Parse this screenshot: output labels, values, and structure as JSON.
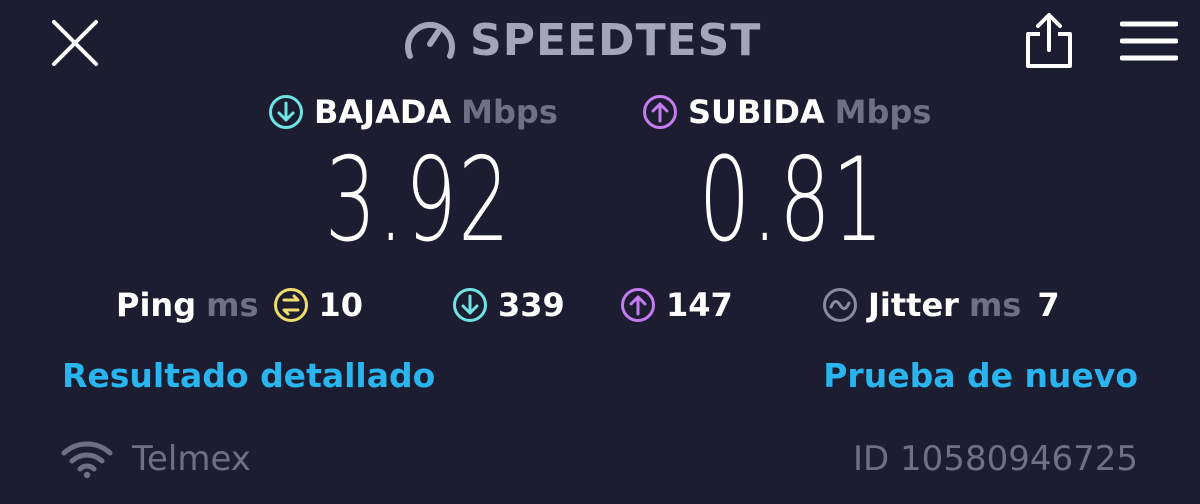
{
  "header": {
    "brand": "SPEEDTEST"
  },
  "download": {
    "label": "BAJADA",
    "unit": "Mbps",
    "value": "3.92"
  },
  "upload": {
    "label": "SUBIDA",
    "unit": "Mbps",
    "value": "0.81"
  },
  "metrics": {
    "ping_label": "Ping",
    "ping_unit": "ms",
    "ping_value": "10",
    "download_latency": "339",
    "upload_latency": "147",
    "jitter_label": "Jitter",
    "jitter_unit": "ms",
    "jitter_value": "7"
  },
  "links": {
    "detailed": "Resultado detallado",
    "retry": "Prueba de nuevo"
  },
  "footer": {
    "isp": "Telmex",
    "result_id": "ID 10580946725"
  },
  "colors": {
    "background": "#1c1d30",
    "download_accent": "#6fe3e3",
    "upload_accent": "#c57cf0",
    "ping_accent": "#f0dc6a",
    "link": "#29b6f0",
    "muted": "#6f7085"
  }
}
